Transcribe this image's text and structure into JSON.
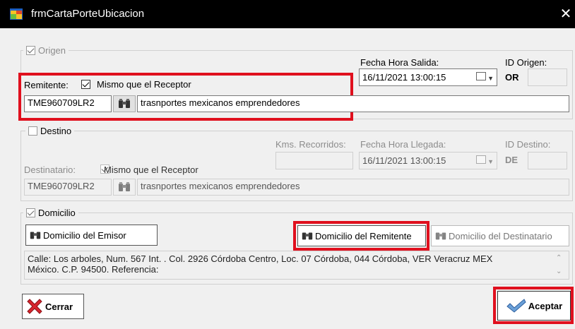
{
  "window": {
    "title": "frmCartaPorteUbicacion",
    "close_glyph": "✕"
  },
  "origen": {
    "label": "Origen",
    "fecha_label": "Fecha Hora Salida:",
    "fecha_value": "16/11/2021 13:00:15",
    "id_label": "ID Origen:",
    "id_prefix": "OR",
    "id_value": "",
    "remitente_label": "Remitente:",
    "mismo_label": "Mismo que el Receptor",
    "rfc": "TME960709LR2",
    "nombre": "trasnportes mexicanos emprendedores"
  },
  "destino": {
    "label": "Destino",
    "kms_label": "Kms. Recorridos:",
    "kms_value": "",
    "fecha_label": "Fecha Hora Llegada:",
    "fecha_value": "16/11/2021 13:00:15",
    "id_label": "ID Destino:",
    "id_prefix": "DE",
    "id_value": "",
    "destinatario_label": "Destinatario:",
    "mismo_label": "Mismo que el Receptor",
    "rfc": "TME960709LR2",
    "nombre": "trasnportes mexicanos emprendedores"
  },
  "domicilio": {
    "label": "Domicilio",
    "emisor_btn": "Domicilio del Emisor",
    "remitente_btn": "Domicilio del Remitente",
    "destinatario_btn": "Domicilio del Destinatario",
    "address_line1": "Calle: Los arboles, Num. 567 Int. . Col. 2926 Córdoba Centro, Loc. 07 Córdoba, 044 Córdoba, VER Veracruz MEX",
    "address_line2": "México.  C.P. 94500. Referencia:"
  },
  "footer": {
    "cerrar": "Cerrar",
    "aceptar": "Aceptar"
  },
  "colors": {
    "highlight": "#e0101e",
    "titlebar": "#000000"
  }
}
